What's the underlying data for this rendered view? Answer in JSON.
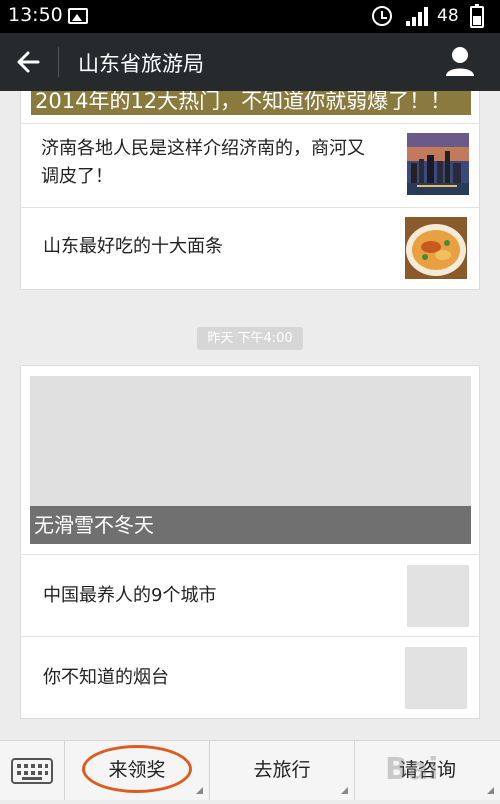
{
  "status": {
    "time": "13:50",
    "battery": "48"
  },
  "header": {
    "title": "山东省旅游局"
  },
  "feed1": {
    "banner_text": "2014年的12大热门，不知道你就弱爆了！！",
    "items": [
      {
        "text": "济南各地人民是这样介绍济南的，商河又调皮了！",
        "thumb": "jinan-city-night-image"
      },
      {
        "text": "山东最好吃的十大面条",
        "thumb": "noodle-bowl-image"
      }
    ]
  },
  "time_divider": "昨天 下午4:00",
  "feed2": {
    "hero_caption": "无滑雪不冬天",
    "items": [
      {
        "text": "中国最养人的9个城市"
      },
      {
        "text": "你不知道的烟台"
      }
    ]
  },
  "bottom_menu": {
    "tabs": [
      {
        "label": "来领奖"
      },
      {
        "label": "去旅行"
      },
      {
        "label": "请咨询"
      }
    ]
  },
  "colors": {
    "titlebar": "#262a2d",
    "highlight_oval": "#e05a1e"
  }
}
